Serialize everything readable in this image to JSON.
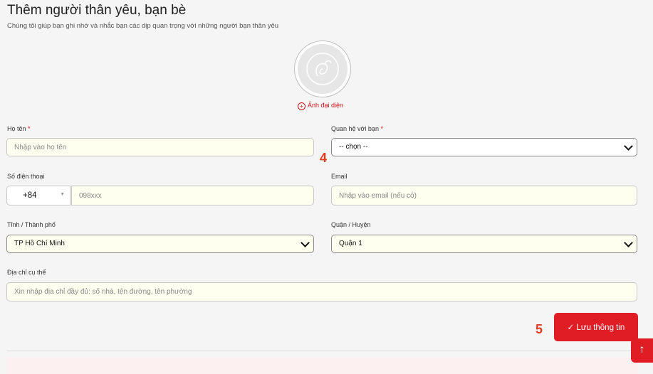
{
  "header": {
    "title": "Thêm người thân yêu, bạn bè",
    "subtitle": "Chúng tôi giúp bạn ghi nhớ và nhắc bạn các dịp quan trọng với những người bạn thân yêu"
  },
  "avatar": {
    "label": "Ảnh đại diện",
    "icon": "plus-circle-icon"
  },
  "form": {
    "name": {
      "label": "Họ tên",
      "required": "*",
      "placeholder": "Nhập vào họ tên"
    },
    "relation": {
      "label": "Quan hệ với bạn",
      "required": "*",
      "selected": "-- chọn --"
    },
    "phone": {
      "label": "Số điện thoại",
      "code": "+84",
      "placeholder": "098xxx"
    },
    "email": {
      "label": "Email",
      "placeholder": "Nhập vào email (nếu có)"
    },
    "province": {
      "label": "Tỉnh / Thành phố",
      "selected": "TP Hồ Chí Minh"
    },
    "district": {
      "label": "Quận / Huyện",
      "selected": "Quận 1"
    },
    "address": {
      "label": "Địa chỉ cụ thể",
      "placeholder": "Xin nhập địa chỉ đầy đủ: số nhà, tên đường, tên phường"
    }
  },
  "markers": {
    "four": "4",
    "five": "5"
  },
  "actions": {
    "save_label": "Lưu thông tin",
    "save_icon": "checkmark-icon",
    "top_icon": "arrow-up-icon"
  },
  "colors": {
    "accent": "#e01c25",
    "field_bg": "#fffff0"
  }
}
